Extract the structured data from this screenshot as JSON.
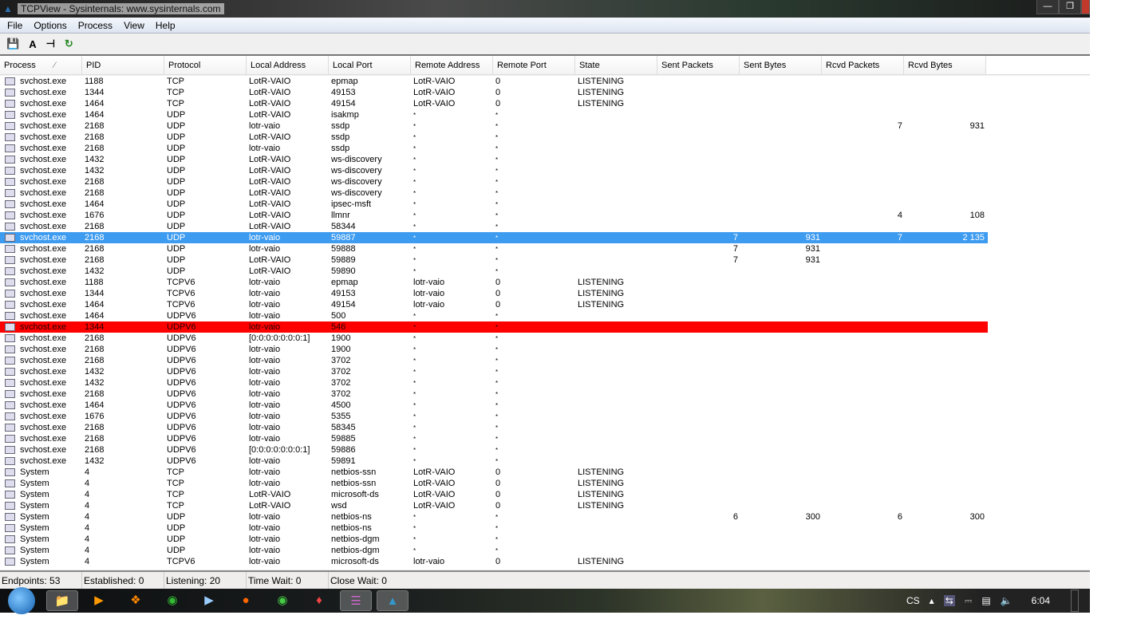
{
  "window": {
    "title": "TCPView - Sysinternals: www.sysinternals.com"
  },
  "menu": [
    "File",
    "Options",
    "Process",
    "View",
    "Help"
  ],
  "toolbar": {
    "icons": [
      "save-icon",
      "font-icon",
      "resolve-addresses-icon",
      "refresh-icon"
    ]
  },
  "columns": [
    "Process",
    "PID",
    "Protocol",
    "Local Address",
    "Local Port",
    "Remote Address",
    "Remote Port",
    "State",
    "Sent Packets",
    "Sent Bytes",
    "Rcvd Packets",
    "Rcvd Bytes"
  ],
  "sort": {
    "column": "Process",
    "direction": "ascending"
  },
  "colors": {
    "selected": "#3d9bf0",
    "highlight_removed": "#ff0000"
  },
  "rows": [
    [
      "svchost.exe",
      "1188",
      "TCP",
      "LotR-VAIO",
      "epmap",
      "LotR-VAIO",
      "0",
      "LISTENING",
      "",
      "",
      "",
      ""
    ],
    [
      "svchost.exe",
      "1344",
      "TCP",
      "LotR-VAIO",
      "49153",
      "LotR-VAIO",
      "0",
      "LISTENING",
      "",
      "",
      "",
      ""
    ],
    [
      "svchost.exe",
      "1464",
      "TCP",
      "LotR-VAIO",
      "49154",
      "LotR-VAIO",
      "0",
      "LISTENING",
      "",
      "",
      "",
      ""
    ],
    [
      "svchost.exe",
      "1464",
      "UDP",
      "LotR-VAIO",
      "isakmp",
      "*",
      "*",
      "",
      "",
      "",
      "",
      ""
    ],
    [
      "svchost.exe",
      "2168",
      "UDP",
      "lotr-vaio",
      "ssdp",
      "*",
      "*",
      "",
      "",
      "",
      "7",
      "931"
    ],
    [
      "svchost.exe",
      "2168",
      "UDP",
      "LotR-VAIO",
      "ssdp",
      "*",
      "*",
      "",
      "",
      "",
      "",
      ""
    ],
    [
      "svchost.exe",
      "2168",
      "UDP",
      "lotr-vaio",
      "ssdp",
      "*",
      "*",
      "",
      "",
      "",
      "",
      ""
    ],
    [
      "svchost.exe",
      "1432",
      "UDP",
      "LotR-VAIO",
      "ws-discovery",
      "*",
      "*",
      "",
      "",
      "",
      "",
      ""
    ],
    [
      "svchost.exe",
      "1432",
      "UDP",
      "LotR-VAIO",
      "ws-discovery",
      "*",
      "*",
      "",
      "",
      "",
      "",
      ""
    ],
    [
      "svchost.exe",
      "2168",
      "UDP",
      "LotR-VAIO",
      "ws-discovery",
      "*",
      "*",
      "",
      "",
      "",
      "",
      ""
    ],
    [
      "svchost.exe",
      "2168",
      "UDP",
      "LotR-VAIO",
      "ws-discovery",
      "*",
      "*",
      "",
      "",
      "",
      "",
      ""
    ],
    [
      "svchost.exe",
      "1464",
      "UDP",
      "LotR-VAIO",
      "ipsec-msft",
      "*",
      "*",
      "",
      "",
      "",
      "",
      ""
    ],
    [
      "svchost.exe",
      "1676",
      "UDP",
      "LotR-VAIO",
      "llmnr",
      "*",
      "*",
      "",
      "",
      "",
      "4",
      "108"
    ],
    [
      "svchost.exe",
      "2168",
      "UDP",
      "LotR-VAIO",
      "58344",
      "*",
      "*",
      "",
      "",
      "",
      "",
      ""
    ],
    [
      "svchost.exe",
      "2168",
      "UDP",
      "lotr-vaio",
      "59887",
      "*",
      "*",
      "",
      "7",
      "931",
      "7",
      "2 135"
    ],
    [
      "svchost.exe",
      "2168",
      "UDP",
      "lotr-vaio",
      "59888",
      "*",
      "*",
      "",
      "7",
      "931",
      "",
      ""
    ],
    [
      "svchost.exe",
      "2168",
      "UDP",
      "LotR-VAIO",
      "59889",
      "*",
      "*",
      "",
      "7",
      "931",
      "",
      ""
    ],
    [
      "svchost.exe",
      "1432",
      "UDP",
      "LotR-VAIO",
      "59890",
      "*",
      "*",
      "",
      "",
      "",
      "",
      ""
    ],
    [
      "svchost.exe",
      "1188",
      "TCPV6",
      "lotr-vaio",
      "epmap",
      "lotr-vaio",
      "0",
      "LISTENING",
      "",
      "",
      "",
      ""
    ],
    [
      "svchost.exe",
      "1344",
      "TCPV6",
      "lotr-vaio",
      "49153",
      "lotr-vaio",
      "0",
      "LISTENING",
      "",
      "",
      "",
      ""
    ],
    [
      "svchost.exe",
      "1464",
      "TCPV6",
      "lotr-vaio",
      "49154",
      "lotr-vaio",
      "0",
      "LISTENING",
      "",
      "",
      "",
      ""
    ],
    [
      "svchost.exe",
      "1464",
      "UDPV6",
      "lotr-vaio",
      "500",
      "*",
      "*",
      "",
      "",
      "",
      "",
      ""
    ],
    [
      "svchost.exe",
      "1344",
      "UDPV6",
      "lotr-vaio",
      "546",
      "*",
      "*",
      "",
      "",
      "",
      "",
      ""
    ],
    [
      "svchost.exe",
      "2168",
      "UDPV6",
      "[0:0:0:0:0:0:0:1]",
      "1900",
      "*",
      "*",
      "",
      "",
      "",
      "",
      ""
    ],
    [
      "svchost.exe",
      "2168",
      "UDPV6",
      "lotr-vaio",
      "1900",
      "*",
      "*",
      "",
      "",
      "",
      "",
      ""
    ],
    [
      "svchost.exe",
      "2168",
      "UDPV6",
      "lotr-vaio",
      "3702",
      "*",
      "*",
      "",
      "",
      "",
      "",
      ""
    ],
    [
      "svchost.exe",
      "1432",
      "UDPV6",
      "lotr-vaio",
      "3702",
      "*",
      "*",
      "",
      "",
      "",
      "",
      ""
    ],
    [
      "svchost.exe",
      "1432",
      "UDPV6",
      "lotr-vaio",
      "3702",
      "*",
      "*",
      "",
      "",
      "",
      "",
      ""
    ],
    [
      "svchost.exe",
      "2168",
      "UDPV6",
      "lotr-vaio",
      "3702",
      "*",
      "*",
      "",
      "",
      "",
      "",
      ""
    ],
    [
      "svchost.exe",
      "1464",
      "UDPV6",
      "lotr-vaio",
      "4500",
      "*",
      "*",
      "",
      "",
      "",
      "",
      ""
    ],
    [
      "svchost.exe",
      "1676",
      "UDPV6",
      "lotr-vaio",
      "5355",
      "*",
      "*",
      "",
      "",
      "",
      "",
      ""
    ],
    [
      "svchost.exe",
      "2168",
      "UDPV6",
      "lotr-vaio",
      "58345",
      "*",
      "*",
      "",
      "",
      "",
      "",
      ""
    ],
    [
      "svchost.exe",
      "2168",
      "UDPV6",
      "lotr-vaio",
      "59885",
      "*",
      "*",
      "",
      "",
      "",
      "",
      ""
    ],
    [
      "svchost.exe",
      "2168",
      "UDPV6",
      "[0:0:0:0:0:0:0:1]",
      "59886",
      "*",
      "*",
      "",
      "",
      "",
      "",
      ""
    ],
    [
      "svchost.exe",
      "1432",
      "UDPV6",
      "lotr-vaio",
      "59891",
      "*",
      "*",
      "",
      "",
      "",
      "",
      ""
    ],
    [
      "System",
      "4",
      "TCP",
      "lotr-vaio",
      "netbios-ssn",
      "LotR-VAIO",
      "0",
      "LISTENING",
      "",
      "",
      "",
      ""
    ],
    [
      "System",
      "4",
      "TCP",
      "lotr-vaio",
      "netbios-ssn",
      "LotR-VAIO",
      "0",
      "LISTENING",
      "",
      "",
      "",
      ""
    ],
    [
      "System",
      "4",
      "TCP",
      "LotR-VAIO",
      "microsoft-ds",
      "LotR-VAIO",
      "0",
      "LISTENING",
      "",
      "",
      "",
      ""
    ],
    [
      "System",
      "4",
      "TCP",
      "LotR-VAIO",
      "wsd",
      "LotR-VAIO",
      "0",
      "LISTENING",
      "",
      "",
      "",
      ""
    ],
    [
      "System",
      "4",
      "UDP",
      "lotr-vaio",
      "netbios-ns",
      "*",
      "*",
      "",
      "6",
      "300",
      "6",
      "300"
    ],
    [
      "System",
      "4",
      "UDP",
      "lotr-vaio",
      "netbios-ns",
      "*",
      "*",
      "",
      "",
      "",
      "",
      ""
    ],
    [
      "System",
      "4",
      "UDP",
      "lotr-vaio",
      "netbios-dgm",
      "*",
      "*",
      "",
      "",
      "",
      "",
      ""
    ],
    [
      "System",
      "4",
      "UDP",
      "lotr-vaio",
      "netbios-dgm",
      "*",
      "*",
      "",
      "",
      "",
      "",
      ""
    ],
    [
      "System",
      "4",
      "TCPV6",
      "lotr-vaio",
      "microsoft-ds",
      "lotr-vaio",
      "0",
      "LISTENING",
      "",
      "",
      "",
      ""
    ]
  ],
  "selected_row": 14,
  "red_row": 22,
  "status": [
    "Endpoints: 53",
    "Established: 0",
    "Listening: 20",
    "Time Wait: 0",
    "Close Wait: 0"
  ],
  "taskbar": {
    "apps": [
      "explorer",
      "media-player",
      "media-center",
      "utorrent",
      "media-app",
      "firefox",
      "chrome",
      "app",
      "winrar",
      "tcpview"
    ],
    "tray": {
      "language": "CS",
      "time": "6:04"
    }
  }
}
